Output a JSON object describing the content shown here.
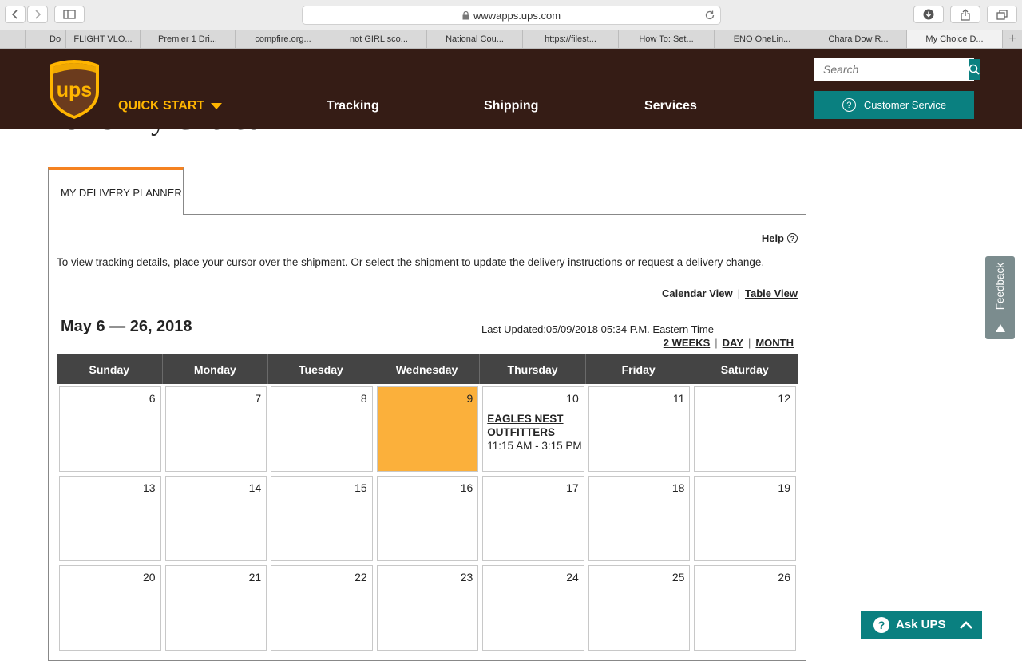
{
  "browser": {
    "url": "wwwapps.ups.com",
    "tabs": [
      "Do",
      "FLIGHT VLO...",
      "Premier 1 Dri...",
      "compfire.org...",
      "not GIRL sco...",
      "National Cou...",
      "https://filest...",
      "How To: Set...",
      "ENO OneLin...",
      "Chara Dow R...",
      "My Choice D..."
    ],
    "active_tab_index": 10
  },
  "header": {
    "quick_start": "QUICK START",
    "nav": [
      "Tracking",
      "Shipping",
      "Services"
    ],
    "search_placeholder": "Search",
    "customer_service": "Customer Service",
    "brand_color": "#351c15",
    "accent_color": "#ffb500",
    "teal_color": "#0a8080"
  },
  "page": {
    "title": "UPS My Choice"
  },
  "planner": {
    "tab_label": "MY DELIVERY PLANNER",
    "help": "Help",
    "instructions": "To view tracking details, place your cursor over the shipment. Or select the shipment to update the delivery instructions or request a delivery change.",
    "calendar_view": "Calendar View",
    "table_view": "Table View",
    "date_range": "May 6 — 26, 2018",
    "last_updated": "Last Updated:05/09/2018 05:34 P.M. Eastern Time",
    "range_options": [
      "2 WEEKS",
      "DAY",
      "MONTH"
    ],
    "weekdays": [
      "Sunday",
      "Monday",
      "Tuesday",
      "Wednesday",
      "Thursday",
      "Friday",
      "Saturday"
    ],
    "days": [
      "6",
      "7",
      "8",
      "9",
      "10",
      "11",
      "12",
      "13",
      "14",
      "15",
      "16",
      "17",
      "18",
      "19",
      "20",
      "21",
      "22",
      "23",
      "24",
      "25",
      "26"
    ],
    "today": "9",
    "today_color": "#fbb03b",
    "shipment": {
      "day": "10",
      "vendor": "EAGLES NEST OUTFITTERS",
      "window": "11:15 AM - 3:15 PM"
    }
  },
  "feedback": "Feedback",
  "ask_ups": "Ask UPS"
}
